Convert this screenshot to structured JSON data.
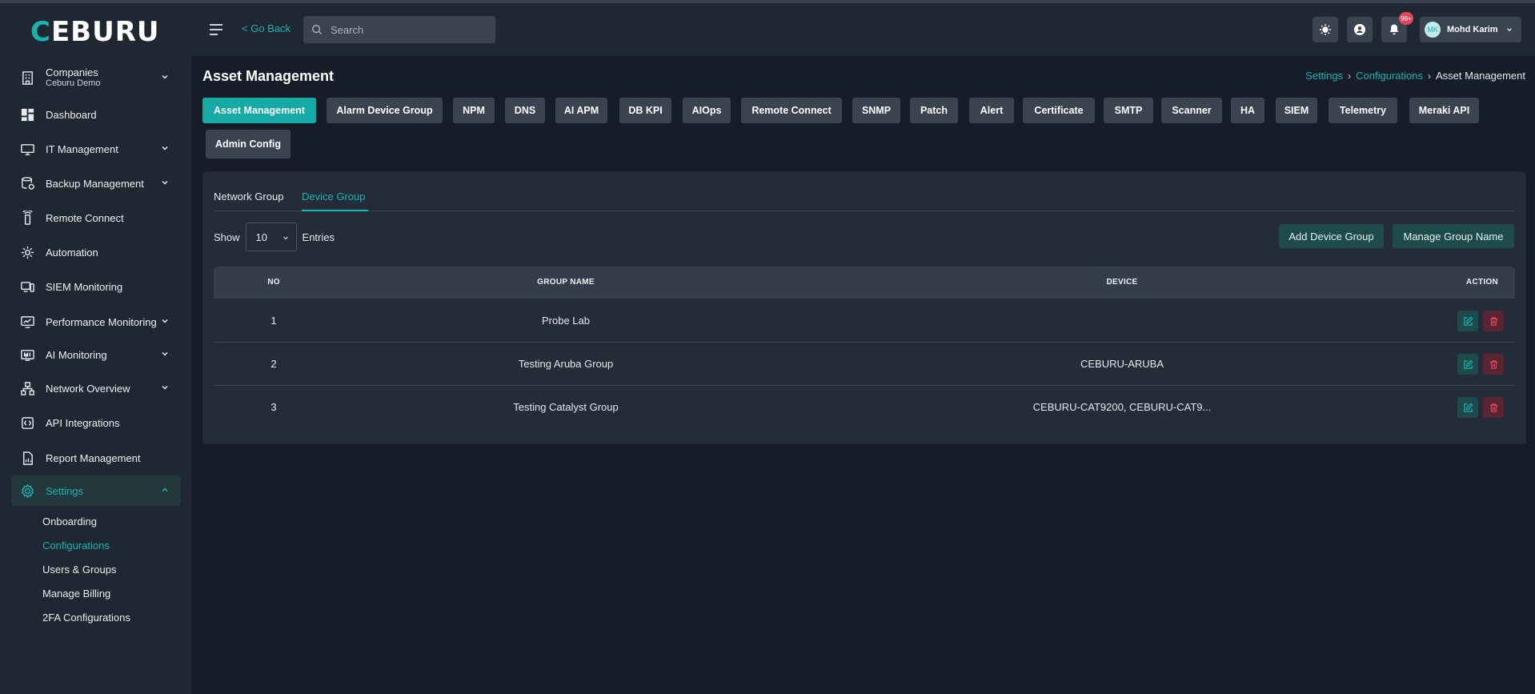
{
  "brand": {
    "logo_text": "EBURU",
    "logo_first": "C"
  },
  "sidebar": {
    "company": {
      "label": "Companies",
      "sub": "Ceburu Demo"
    },
    "items": [
      {
        "label": "Dashboard",
        "icon": "dashboard-icon"
      },
      {
        "label": "IT Management",
        "icon": "it-management-icon"
      },
      {
        "label": "Backup Management",
        "icon": "backup-icon"
      },
      {
        "label": "Remote Connect",
        "icon": "remote-connect-icon"
      },
      {
        "label": "Automation",
        "icon": "automation-icon"
      },
      {
        "label": "SIEM Monitoring",
        "icon": "siem-icon"
      },
      {
        "label": "Performance Monitoring",
        "icon": "performance-icon"
      },
      {
        "label": "AI Monitoring",
        "icon": "ai-monitoring-icon"
      },
      {
        "label": "Network Overview",
        "icon": "network-icon"
      },
      {
        "label": "API Integrations",
        "icon": "api-icon"
      },
      {
        "label": "Report Management",
        "icon": "report-icon"
      },
      {
        "label": "Settings",
        "icon": "settings-icon"
      }
    ],
    "settings_sub": [
      "Onboarding",
      "Configurations",
      "Users & Groups",
      "Manage Billing",
      "2FA Configurations"
    ]
  },
  "header": {
    "go_back": "< Go Back",
    "search_placeholder": "Search",
    "notif_badge": "99+",
    "user_initials": "MK",
    "user_name": "Mohd Karim"
  },
  "page": {
    "title": "Asset Management",
    "breadcrumb": [
      "Settings",
      "Configurations",
      "Asset Management"
    ]
  },
  "config_tabs": [
    "Asset Management",
    "Alarm Device Group",
    "NPM",
    "DNS",
    "AI APM",
    "DB KPI",
    "AIOps",
    "Remote Connect",
    "SNMP",
    "Patch",
    "Alert",
    "Certificate",
    "SMTP",
    "Scanner",
    "HA",
    "SIEM",
    "Telemetry",
    "Meraki API",
    "Admin Config"
  ],
  "sub_tabs": [
    "Network Group",
    "Device Group"
  ],
  "list_controls": {
    "show_label": "Show",
    "entries_value": "10",
    "entries_label": "Entries",
    "add_button": "Add Device Group",
    "manage_button": "Manage Group Name"
  },
  "table": {
    "headers": [
      "NO",
      "GROUP NAME",
      "DEVICE",
      "ACTION"
    ],
    "rows": [
      {
        "no": "1",
        "group": "Probe Lab",
        "device": ""
      },
      {
        "no": "2",
        "group": "Testing Aruba Group",
        "device": "CEBURU-ARUBA"
      },
      {
        "no": "3",
        "group": "Testing Catalyst Group",
        "device": "CEBURU-CAT9200, CEBURU-CAT9..."
      }
    ]
  },
  "colors": {
    "accent": "#19b4b0",
    "background": "#161d28",
    "panel": "#1f2732",
    "danger": "#e0475b"
  }
}
